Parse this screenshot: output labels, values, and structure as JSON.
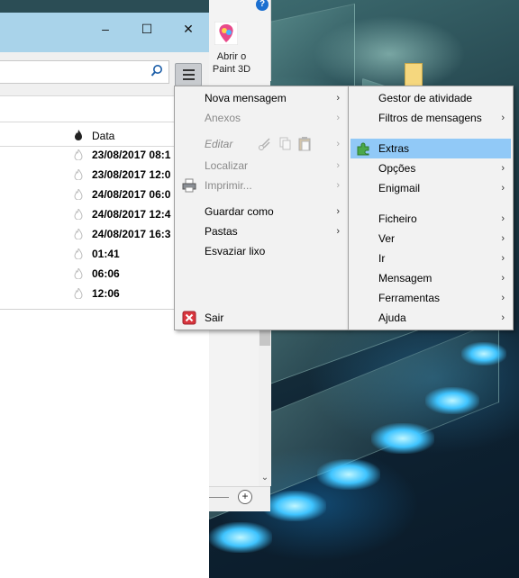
{
  "ribbon": {
    "help_label": "?",
    "paint3d_label": "Abrir o Paint 3D"
  },
  "window": {
    "minimize": "–",
    "maximize": "☐",
    "close": "✕"
  },
  "columns": {
    "date": "Data"
  },
  "messages": [
    {
      "date": "23/08/2017 08:1"
    },
    {
      "date": "23/08/2017 12:0"
    },
    {
      "date": "24/08/2017 06:0"
    },
    {
      "date": "24/08/2017 12:4"
    },
    {
      "date": "24/08/2017 16:3"
    },
    {
      "date": "01:41"
    },
    {
      "date": "06:06"
    },
    {
      "date": "12:06"
    }
  ],
  "menu_left": {
    "nova_mensagem": "Nova mensagem",
    "anexos": "Anexos",
    "editar": "Editar",
    "localizar": "Localizar",
    "imprimir": "Imprimir...",
    "guardar_como": "Guardar como",
    "pastas": "Pastas",
    "esvaziar_lixo": "Esvaziar lixo",
    "sair": "Sair"
  },
  "menu_right": {
    "gestor_atividade": "Gestor de atividade",
    "filtros_mensagens": "Filtros de mensagens",
    "extras": "Extras",
    "opcoes": "Opções",
    "enigmail": "Enigmail",
    "ficheiro": "Ficheiro",
    "ver": "Ver",
    "ir": "Ir",
    "mensagem": "Mensagem",
    "ferramentas": "Ferramentas",
    "ajuda": "Ajuda"
  },
  "arrow": "›",
  "colors": {
    "titlebar": "#a9d3ea",
    "menu_highlight": "#91c9f7",
    "menu_bg": "#f2f2f2"
  }
}
